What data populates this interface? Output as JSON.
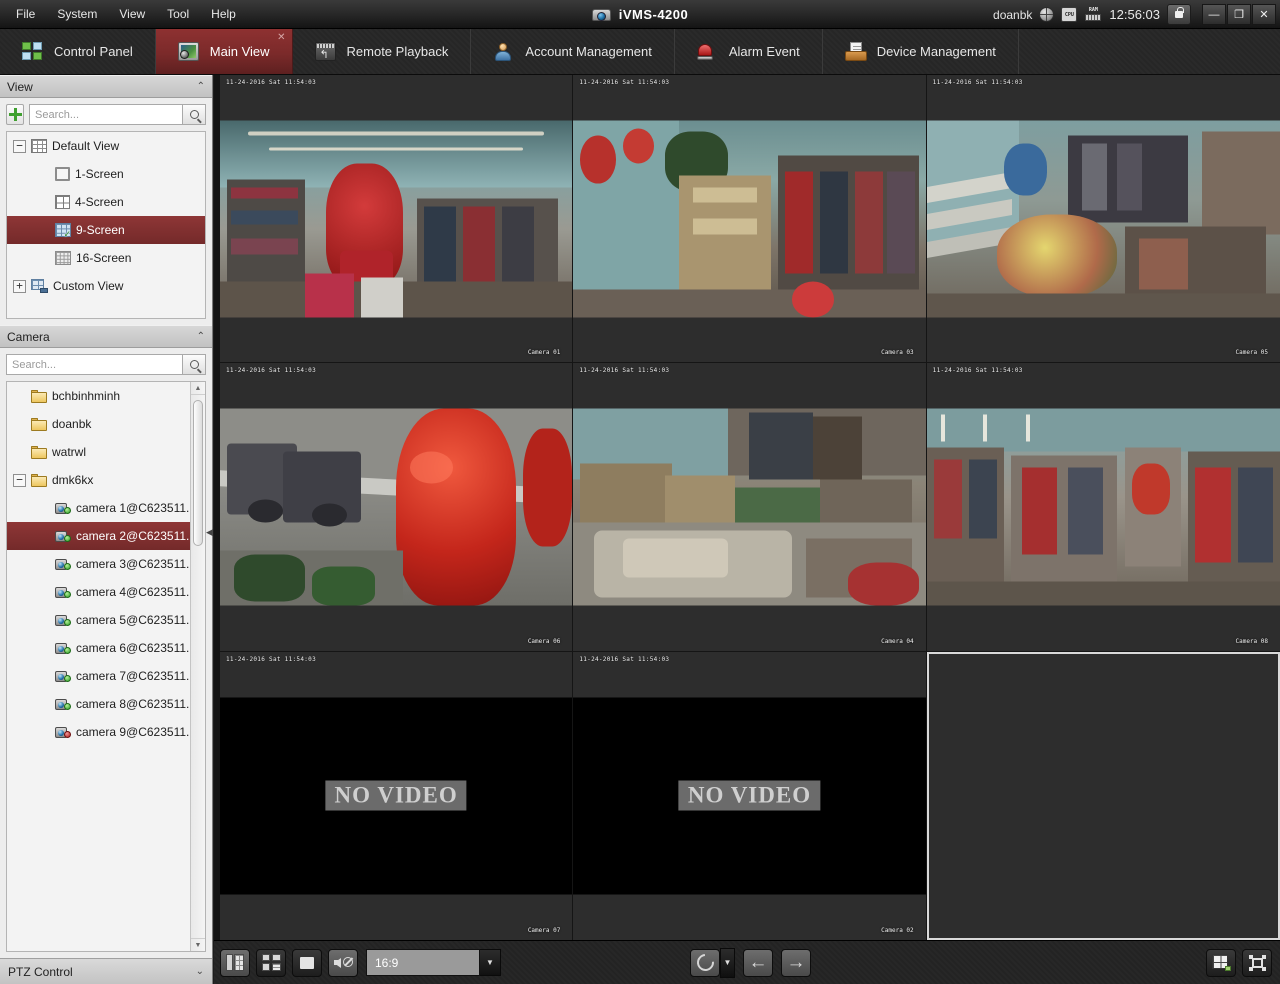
{
  "titlebar": {
    "app_title": "iVMS-4200",
    "app_icon": "camera-logo-icon",
    "menus": [
      {
        "label": "File"
      },
      {
        "label": "System"
      },
      {
        "label": "View"
      },
      {
        "label": "Tool"
      },
      {
        "label": "Help"
      }
    ],
    "user": "doanbk",
    "time": "12:56:03",
    "status_icons": [
      "globe-icon",
      "cpu-icon",
      "ram-icon"
    ],
    "cpu_label": "CPU",
    "ram_label": "RAM",
    "lock_icon": "lock-icon",
    "window_buttons": {
      "minimize": "—",
      "restore": "❐",
      "close": "✕"
    }
  },
  "nav": {
    "tabs": [
      {
        "label": "Control Panel",
        "icon": "grid-panel-icon",
        "active": false,
        "closable": false
      },
      {
        "label": "Main View",
        "icon": "main-view-icon",
        "active": true,
        "closable": true,
        "close_glyph": "✕"
      },
      {
        "label": "Remote Playback",
        "icon": "playback-icon",
        "active": false,
        "closable": false
      },
      {
        "label": "Account Management",
        "icon": "account-icon",
        "active": false,
        "closable": false
      },
      {
        "label": "Alarm Event",
        "icon": "alarm-icon",
        "active": false,
        "closable": false
      },
      {
        "label": "Device Management",
        "icon": "device-icon",
        "active": false,
        "closable": false
      }
    ]
  },
  "view_panel": {
    "title": "View",
    "collapse_glyph": "⌃",
    "add_button_label": "+",
    "search_placeholder": "Search...",
    "search_value": "",
    "tree": [
      {
        "label": "Default View",
        "icon": "default-view-icon",
        "expander": "−",
        "level": 0,
        "selected": false
      },
      {
        "label": "1-Screen",
        "icon": "screen-1-icon",
        "expander": "",
        "level": 1,
        "selected": false
      },
      {
        "label": "4-Screen",
        "icon": "screen-4-icon",
        "expander": "",
        "level": 1,
        "selected": false
      },
      {
        "label": "9-Screen",
        "icon": "screen-9-icon",
        "expander": "",
        "level": 1,
        "selected": true
      },
      {
        "label": "16-Screen",
        "icon": "screen-16-icon",
        "expander": "",
        "level": 1,
        "selected": false
      },
      {
        "label": "Custom View",
        "icon": "custom-view-icon",
        "expander": "+",
        "level": 0,
        "selected": false
      }
    ]
  },
  "camera_panel": {
    "title": "Camera",
    "collapse_glyph": "⌃",
    "search_placeholder": "Search...",
    "search_value": "",
    "tree": [
      {
        "label": "bchbinhminh",
        "type": "folder",
        "expander": "",
        "level": 0,
        "selected": false,
        "status": "on"
      },
      {
        "label": "doanbk",
        "type": "folder",
        "expander": "",
        "level": 0,
        "selected": false,
        "status": "on"
      },
      {
        "label": "watrwl",
        "type": "folder",
        "expander": "",
        "level": 0,
        "selected": false,
        "status": "on"
      },
      {
        "label": "dmk6kx",
        "type": "folder",
        "expander": "−",
        "level": 0,
        "selected": false,
        "status": "on"
      },
      {
        "label": "camera 1@C623511...",
        "type": "camera",
        "expander": "",
        "level": 1,
        "selected": false,
        "status": "on"
      },
      {
        "label": "camera 2@C623511...",
        "type": "camera",
        "expander": "",
        "level": 1,
        "selected": true,
        "status": "on"
      },
      {
        "label": "camera 3@C623511...",
        "type": "camera",
        "expander": "",
        "level": 1,
        "selected": false,
        "status": "on"
      },
      {
        "label": "camera 4@C623511...",
        "type": "camera",
        "expander": "",
        "level": 1,
        "selected": false,
        "status": "on"
      },
      {
        "label": "camera 5@C623511...",
        "type": "camera",
        "expander": "",
        "level": 1,
        "selected": false,
        "status": "on"
      },
      {
        "label": "camera 6@C623511...",
        "type": "camera",
        "expander": "",
        "level": 1,
        "selected": false,
        "status": "on"
      },
      {
        "label": "camera 7@C623511...",
        "type": "camera",
        "expander": "",
        "level": 1,
        "selected": false,
        "status": "on"
      },
      {
        "label": "camera 8@C623511...",
        "type": "camera",
        "expander": "",
        "level": 1,
        "selected": false,
        "status": "on"
      },
      {
        "label": "camera 9@C623511...",
        "type": "camera",
        "expander": "",
        "level": 1,
        "selected": false,
        "status": "off"
      }
    ],
    "scroll_up_glyph": "▲",
    "scroll_down_glyph": "▼"
  },
  "ptz_panel": {
    "title": "PTZ Control",
    "expand_glyph": "⌄"
  },
  "video_grid": {
    "layout": "3x3",
    "selected_cell_index": 8,
    "no_video_text": "NO VIDEO",
    "cells": [
      {
        "osd": "11-24-2016 Sat 11:54:03",
        "camera_label": "Camera 01",
        "state": "live",
        "scene": "boutique-teal"
      },
      {
        "osd": "11-24-2016 Sat 11:54:03",
        "camera_label": "Camera 03",
        "state": "live",
        "scene": "boutique-racks"
      },
      {
        "osd": "11-24-2016 Sat 11:54:03",
        "camera_label": "Camera 05",
        "state": "live",
        "scene": "stairs-flowers"
      },
      {
        "osd": "11-24-2016 Sat 11:54:03",
        "camera_label": "Camera 06",
        "state": "live",
        "scene": "street-balloons"
      },
      {
        "osd": "11-24-2016 Sat 11:54:03",
        "camera_label": "Camera 04",
        "state": "live",
        "scene": "storage-room"
      },
      {
        "osd": "11-24-2016 Sat 11:54:03",
        "camera_label": "Camera 08",
        "state": "live",
        "scene": "boutique-wide"
      },
      {
        "osd": "11-24-2016 Sat 11:54:03",
        "camera_label": "Camera 07",
        "state": "no-video",
        "scene": ""
      },
      {
        "osd": "11-24-2016 Sat 11:54:03",
        "camera_label": "Camera 02",
        "state": "no-video",
        "scene": ""
      },
      {
        "osd": "",
        "camera_label": "",
        "state": "empty",
        "scene": ""
      }
    ]
  },
  "bottom_toolbar": {
    "buttons": [
      {
        "name": "capture-button",
        "icon": "capture-icon"
      },
      {
        "name": "multi-capture-button",
        "icon": "multi-capture-icon"
      },
      {
        "name": "stop-all-button",
        "icon": "stop-icon"
      },
      {
        "name": "mute-button",
        "icon": "mute-icon"
      }
    ],
    "aspect_ratio": "16:9",
    "aspect_dropdown_glyph": "▼",
    "loop_icon": "loop-icon",
    "loop_dropdown_glyph": "▼",
    "prev_glyph": "←",
    "next_glyph": "→",
    "layout_icon": "layout-icon",
    "layout_dropdown_glyph": "▾",
    "fullscreen_icon": "fullscreen-icon"
  },
  "colors": {
    "accent_red": "#8e3131",
    "titlebar_dark": "#2a2a2a",
    "panel_light": "#ededed",
    "video_bg": "#2d2d2d",
    "selection_border": "#d9d9d9"
  }
}
